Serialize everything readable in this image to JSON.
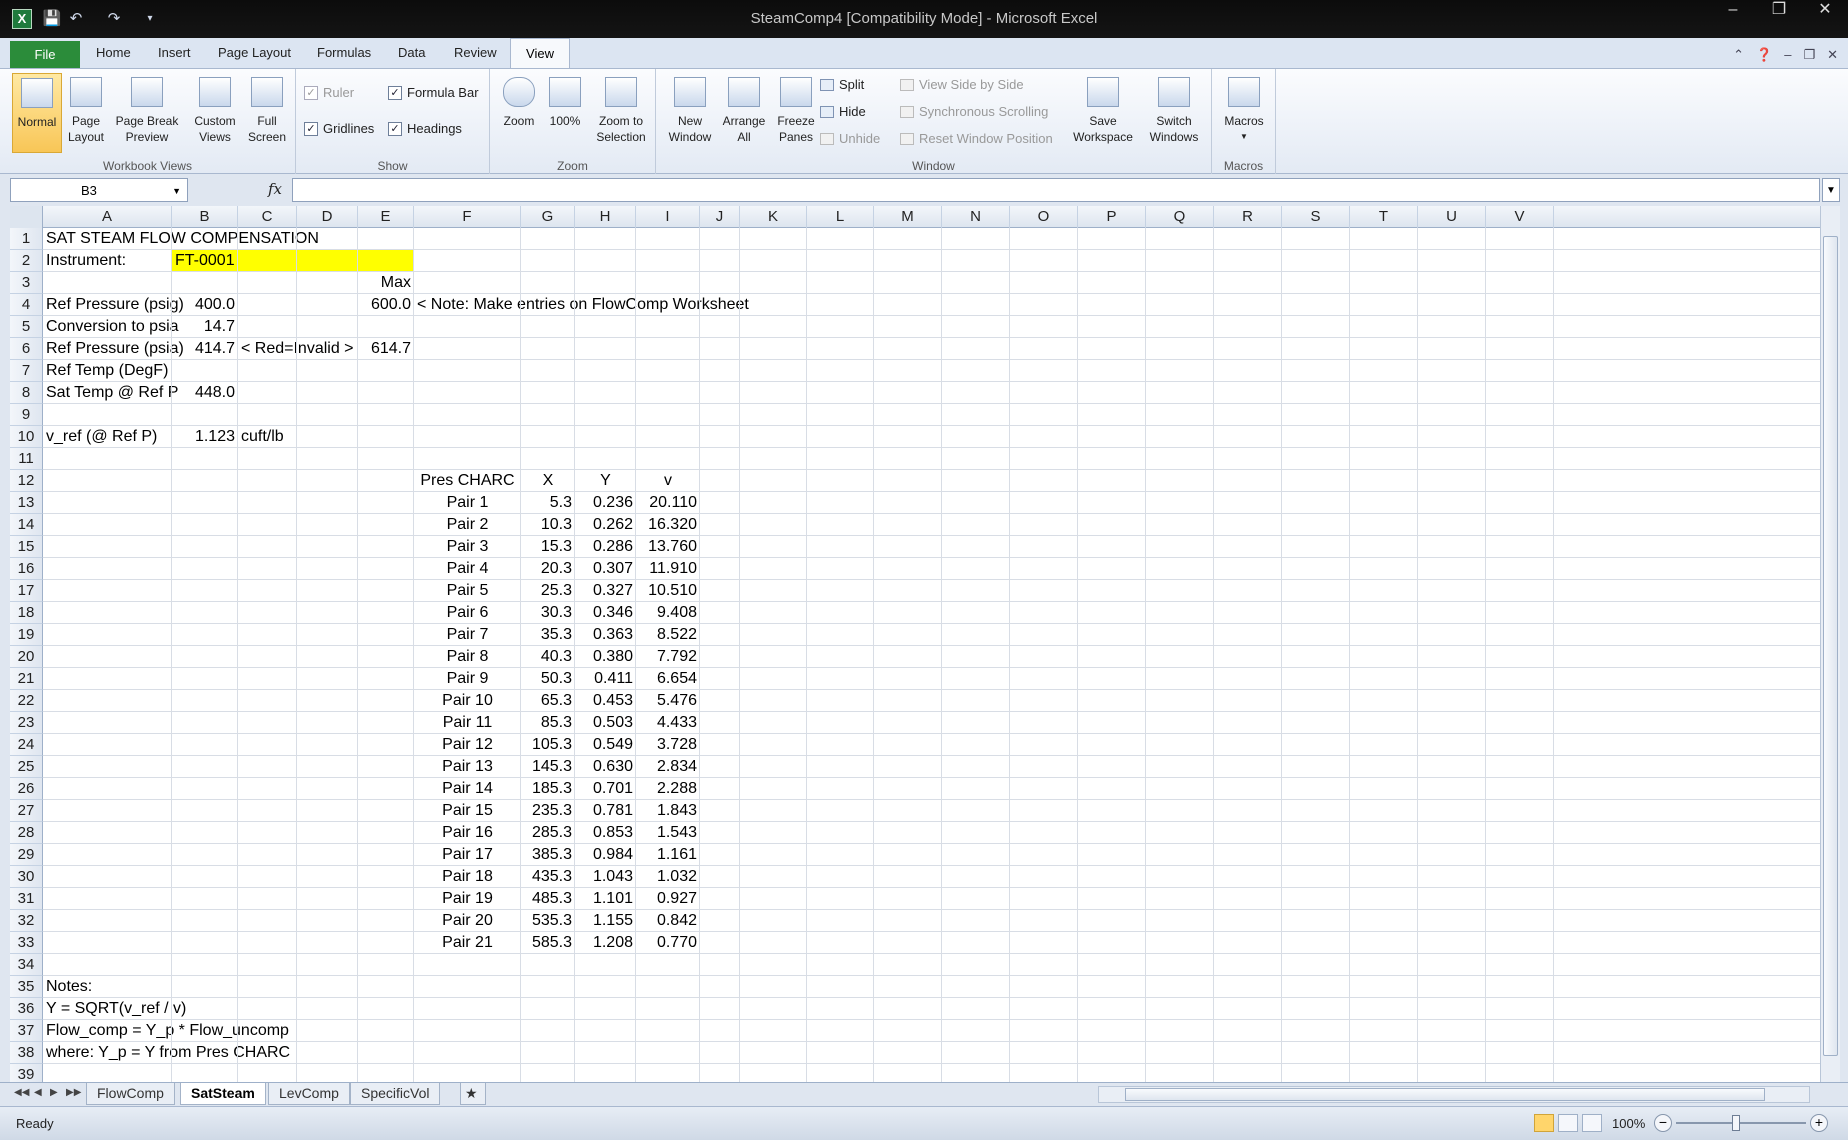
{
  "titlebar": {
    "title": "SteamComp4  [Compatibility Mode]  -  Microsoft Excel",
    "app_icon": "X"
  },
  "ribbon_tabs": {
    "file": "File",
    "home": "Home",
    "insert": "Insert",
    "page_layout": "Page Layout",
    "formulas": "Formulas",
    "data": "Data",
    "review": "Review",
    "view": "View"
  },
  "ribbon": {
    "workbook_views": {
      "label": "Workbook Views",
      "normal": "Normal",
      "page_layout_1": "Page",
      "page_layout_2": "Layout",
      "page_break_1": "Page Break",
      "page_break_2": "Preview",
      "custom_1": "Custom",
      "custom_2": "Views",
      "full_1": "Full",
      "full_2": "Screen"
    },
    "show": {
      "label": "Show",
      "ruler": "Ruler",
      "formula_bar": "Formula Bar",
      "gridlines": "Gridlines",
      "headings": "Headings"
    },
    "zoom": {
      "label": "Zoom",
      "zoom": "Zoom",
      "hundred": "100%",
      "zoom_sel_1": "Zoom to",
      "zoom_sel_2": "Selection"
    },
    "window": {
      "label": "Window",
      "new_1": "New",
      "new_2": "Window",
      "arrange_1": "Arrange",
      "arrange_2": "All",
      "freeze_1": "Freeze",
      "freeze_2": "Panes",
      "split": "Split",
      "hide": "Hide",
      "unhide": "Unhide",
      "side_by_side": "View Side by Side",
      "sync_scroll": "Synchronous Scrolling",
      "reset_pos": "Reset Window Position",
      "save_1": "Save",
      "save_2": "Workspace",
      "switch_1": "Switch",
      "switch_2": "Windows"
    },
    "macros": {
      "label": "Macros",
      "macros": "Macros"
    }
  },
  "formula_bar": {
    "name_box": "B3",
    "fx": "fx",
    "formula": ""
  },
  "columns": [
    "A",
    "B",
    "C",
    "D",
    "E",
    "F",
    "G",
    "H",
    "I",
    "J",
    "K",
    "L",
    "M",
    "N",
    "O",
    "P",
    "Q",
    "R",
    "S",
    "T",
    "U",
    "V"
  ],
  "rows": [
    "1",
    "2",
    "3",
    "4",
    "5",
    "6",
    "7",
    "8",
    "9",
    "10",
    "11",
    "12",
    "13",
    "14",
    "15",
    "16",
    "17",
    "18",
    "19",
    "20",
    "21",
    "22",
    "23",
    "24",
    "25",
    "26",
    "27",
    "28",
    "29",
    "30",
    "31",
    "32",
    "33",
    "34",
    "35",
    "36",
    "37",
    "38",
    "39"
  ],
  "cells": {
    "a1": "SAT STEAM FLOW COMPENSATION",
    "a2": "Instrument:",
    "b2": "FT-0001",
    "e3": "Max",
    "a4": "Ref Pressure (psig)",
    "b4": "400.0",
    "e4": "600.0",
    "f4": "< Note: Make entries on FlowComp Worksheet",
    "a5": "Conversion to psia",
    "b5": "14.7",
    "a6": "Ref Pressure (psia)",
    "b6": "414.7",
    "c6": "< Red=Invalid >",
    "e6": "614.7",
    "a7": "Ref Temp (DegF)",
    "a8": "Sat Temp @ Ref P",
    "b8": "448.0",
    "a10": "v_ref (@ Ref P)",
    "b10": "1.123",
    "c10": "cuft/lb",
    "a35": "Notes:",
    "a36": "Y = SQRT(v_ref / v)",
    "a37": "Flow_comp = Y_p * Flow_uncomp",
    "a38": "where: Y_p = Y from Pres CHARC"
  },
  "table_header": {
    "f": "Pres CHARC",
    "g": "X",
    "h": "Y",
    "i": "v"
  },
  "table": [
    {
      "pair": "Pair 1",
      "x": "5.3",
      "y": "0.236",
      "v": "20.110"
    },
    {
      "pair": "Pair 2",
      "x": "10.3",
      "y": "0.262",
      "v": "16.320"
    },
    {
      "pair": "Pair 3",
      "x": "15.3",
      "y": "0.286",
      "v": "13.760"
    },
    {
      "pair": "Pair 4",
      "x": "20.3",
      "y": "0.307",
      "v": "11.910"
    },
    {
      "pair": "Pair 5",
      "x": "25.3",
      "y": "0.327",
      "v": "10.510"
    },
    {
      "pair": "Pair 6",
      "x": "30.3",
      "y": "0.346",
      "v": "9.408"
    },
    {
      "pair": "Pair 7",
      "x": "35.3",
      "y": "0.363",
      "v": "8.522"
    },
    {
      "pair": "Pair 8",
      "x": "40.3",
      "y": "0.380",
      "v": "7.792"
    },
    {
      "pair": "Pair 9",
      "x": "50.3",
      "y": "0.411",
      "v": "6.654"
    },
    {
      "pair": "Pair 10",
      "x": "65.3",
      "y": "0.453",
      "v": "5.476"
    },
    {
      "pair": "Pair 11",
      "x": "85.3",
      "y": "0.503",
      "v": "4.433"
    },
    {
      "pair": "Pair 12",
      "x": "105.3",
      "y": "0.549",
      "v": "3.728"
    },
    {
      "pair": "Pair 13",
      "x": "145.3",
      "y": "0.630",
      "v": "2.834"
    },
    {
      "pair": "Pair 14",
      "x": "185.3",
      "y": "0.701",
      "v": "2.288"
    },
    {
      "pair": "Pair 15",
      "x": "235.3",
      "y": "0.781",
      "v": "1.843"
    },
    {
      "pair": "Pair 16",
      "x": "285.3",
      "y": "0.853",
      "v": "1.543"
    },
    {
      "pair": "Pair 17",
      "x": "385.3",
      "y": "0.984",
      "v": "1.161"
    },
    {
      "pair": "Pair 18",
      "x": "435.3",
      "y": "1.043",
      "v": "1.032"
    },
    {
      "pair": "Pair 19",
      "x": "485.3",
      "y": "1.101",
      "v": "0.927"
    },
    {
      "pair": "Pair 20",
      "x": "535.3",
      "y": "1.155",
      "v": "0.842"
    },
    {
      "pair": "Pair 21",
      "x": "585.3",
      "y": "1.208",
      "v": "0.770"
    }
  ],
  "sheet_tabs": [
    "FlowComp",
    "SatSteam",
    "LevComp",
    "SpecificVol"
  ],
  "active_sheet": "SatSteam",
  "status": {
    "ready": "Ready",
    "zoom": "100%"
  },
  "colors": {
    "highlight": "#ffff00",
    "file_tab": "#2b8c3a",
    "normal_view_active": "#f8c657"
  }
}
